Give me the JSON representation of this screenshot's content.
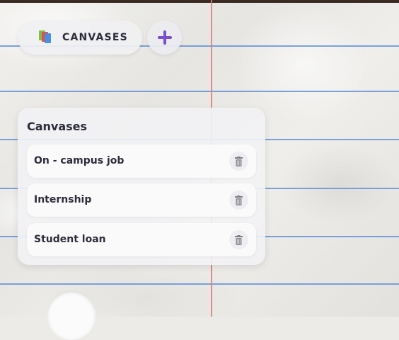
{
  "toolbar": {
    "canvases_label": "CANVASES",
    "canvases_icon": "stacked-cards-icon",
    "add_icon": "plus-icon",
    "add_color": "#7a4fcf"
  },
  "panel": {
    "title": "Canvases",
    "items": [
      {
        "label": "On - campus job",
        "delete_icon": "trash-icon"
      },
      {
        "label": "Internship",
        "delete_icon": "trash-icon"
      },
      {
        "label": "Student loan",
        "delete_icon": "trash-icon"
      }
    ]
  },
  "colors": {
    "rule_line": "#5b8fd6",
    "margin_line": "#e07a74",
    "text": "#2c2c3a"
  }
}
